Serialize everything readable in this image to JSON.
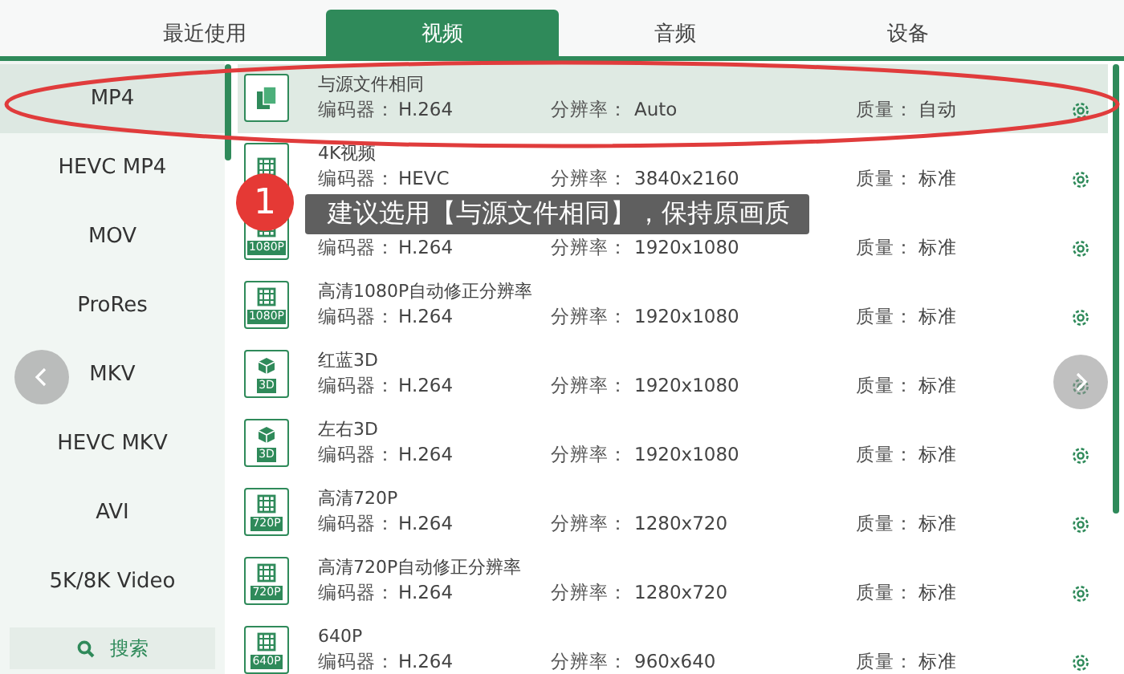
{
  "tabs": [
    {
      "label": "最近使用",
      "selected": false
    },
    {
      "label": "视频",
      "selected": true
    },
    {
      "label": "音频",
      "selected": false
    },
    {
      "label": "设备",
      "selected": false
    }
  ],
  "sidebar": {
    "items": [
      {
        "label": "MP4",
        "selected": true
      },
      {
        "label": "HEVC MP4",
        "selected": false
      },
      {
        "label": "MOV",
        "selected": false
      },
      {
        "label": "ProRes",
        "selected": false
      },
      {
        "label": "MKV",
        "selected": false
      },
      {
        "label": "HEVC MKV",
        "selected": false
      },
      {
        "label": "AVI",
        "selected": false
      },
      {
        "label": "5K/8K Video",
        "selected": false
      }
    ],
    "search": "搜索"
  },
  "presets": [
    {
      "kind": "copy",
      "title": "与源文件相同",
      "selected": true,
      "codec_label": "编码器：",
      "codec": "H.264",
      "res_label": "分辨率：",
      "resolution": "Auto",
      "quality_label": "质量：",
      "quality": "自动"
    },
    {
      "kind": "film",
      "title": "4K视频",
      "selected": false,
      "codec_label": "编码器：",
      "codec": "HEVC",
      "res_label": "分辨率：",
      "resolution": "3840x2160",
      "quality_label": "质量：",
      "quality": "标准"
    },
    {
      "kind": "film",
      "badge": "1080P",
      "selected": false,
      "codec_label": "编码器：",
      "codec": "H.264",
      "res_label": "分辨率：",
      "resolution": "1920x1080",
      "quality_label": "质量：",
      "quality": "标准"
    },
    {
      "kind": "film",
      "badge": "1080P",
      "title": "高清1080P自动修正分辨率",
      "selected": false,
      "codec_label": "编码器：",
      "codec": "H.264",
      "res_label": "分辨率：",
      "resolution": "1920x1080",
      "quality_label": "质量：",
      "quality": "标准"
    },
    {
      "kind": "cube",
      "badge": "3D",
      "title": "红蓝3D",
      "selected": false,
      "codec_label": "编码器：",
      "codec": "H.264",
      "res_label": "分辨率：",
      "resolution": "1920x1080",
      "quality_label": "质量：",
      "quality": "标准"
    },
    {
      "kind": "cube",
      "badge": "3D",
      "title": "左右3D",
      "selected": false,
      "codec_label": "编码器：",
      "codec": "H.264",
      "res_label": "分辨率：",
      "resolution": "1920x1080",
      "quality_label": "质量：",
      "quality": "标准"
    },
    {
      "kind": "film",
      "badge": "720P",
      "title": "高清720P",
      "selected": false,
      "codec_label": "编码器：",
      "codec": "H.264",
      "res_label": "分辨率：",
      "resolution": "1280x720",
      "quality_label": "质量：",
      "quality": "标准"
    },
    {
      "kind": "film",
      "badge": "720P",
      "title": "高清720P自动修正分辨率",
      "selected": false,
      "codec_label": "编码器：",
      "codec": "H.264",
      "res_label": "分辨率：",
      "resolution": "1280x720",
      "quality_label": "质量：",
      "quality": "标准"
    },
    {
      "kind": "film",
      "badge": "640P",
      "title": "640P",
      "selected": false,
      "codec_label": "编码器：",
      "codec": "H.264",
      "res_label": "分辨率：",
      "resolution": "960x640",
      "quality_label": "质量：",
      "quality": "标准"
    }
  ],
  "callout": {
    "number": "1",
    "text": "建议选用【与源文件相同】，保持原画质"
  }
}
